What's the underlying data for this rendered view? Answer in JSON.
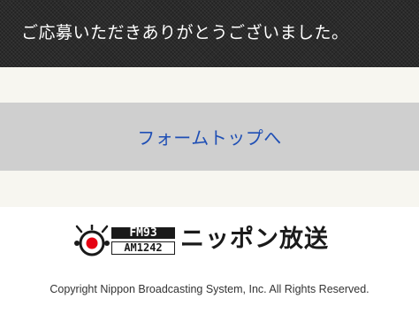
{
  "header": {
    "title": "ご応募いただきありがとうございました。"
  },
  "main": {
    "top_link_label": "フォームトップへ"
  },
  "footer": {
    "logo": {
      "fm_label": "FM93",
      "am_label": "AM1242",
      "brand_name": "ニッポン放送"
    },
    "copyright": "Copyright Nippon Broadcasting System, Inc. All Rights Reserved."
  },
  "colors": {
    "header_bg": "#2b2b2b",
    "content_bg": "#f7f6f0",
    "button_bg": "#cfcfcf",
    "link_color": "#1f4fb5",
    "logo_red": "#e60012"
  }
}
